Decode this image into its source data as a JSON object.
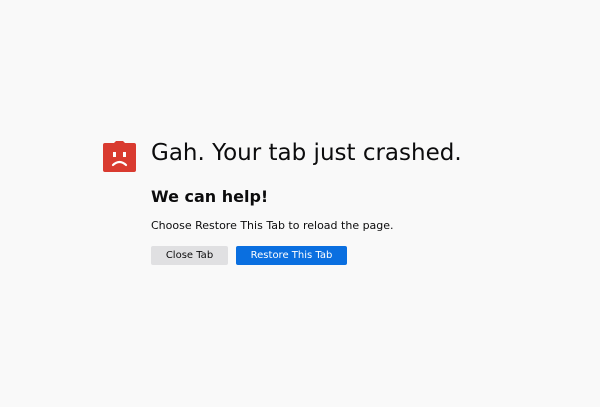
{
  "crash_page": {
    "icon": "sad-tab-icon",
    "title": "Gah. Your tab just crashed.",
    "subtitle": "We can help!",
    "message": "Choose Restore This Tab to reload the page.",
    "close_label": "Close Tab",
    "restore_label": "Restore This Tab"
  },
  "colors": {
    "background": "#f9f9f9",
    "icon": "#d93b30",
    "primary_button": "#0a6fe0",
    "secondary_button": "#e0e0e2"
  }
}
